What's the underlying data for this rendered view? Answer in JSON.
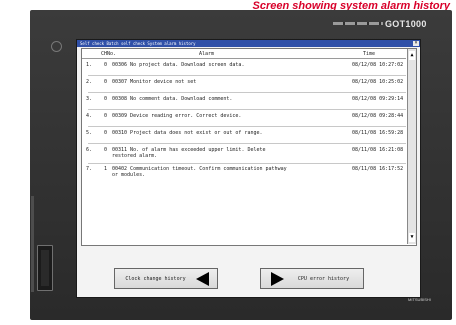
{
  "caption": "Screen showing system alarm history",
  "device": {
    "brand": "GOT1000",
    "maker": "MITSUBISHI"
  },
  "window": {
    "title": "Self check Batch self check System alarm history",
    "close_icon": "close-icon"
  },
  "table": {
    "headers": {
      "no": "CHNo.",
      "alarm": "Alarm",
      "time": "Time"
    },
    "rows": [
      {
        "idx": "1.",
        "ch": "0",
        "message": "00306 No project data. Download screen data.",
        "time": "08/12/08 10:27:02"
      },
      {
        "idx": "2.",
        "ch": "0",
        "message": "00307 Monitor device not set",
        "time": "08/12/08 10:25:02"
      },
      {
        "idx": "3.",
        "ch": "0",
        "message": "00308 No comment data. Download comment.",
        "time": "08/12/08 09:29:14"
      },
      {
        "idx": "4.",
        "ch": "0",
        "message": "00309 Device reading error. Correct device.",
        "time": "08/12/08 09:28:44"
      },
      {
        "idx": "5.",
        "ch": "0",
        "message": "00310 Project data does not exist or out of range.",
        "time": "08/11/08 16:59:28"
      },
      {
        "idx": "6.",
        "ch": "0",
        "message": "00311 No. of alarm has exceeded upper limit. Delete restored alarm.",
        "time": "08/11/08 16:21:08"
      },
      {
        "idx": "7.",
        "ch": "1",
        "message": "00402 Communication timeout. Confirm communication pathway or modules.",
        "time": "08/11/08 16:17:52"
      }
    ]
  },
  "buttons": {
    "clock_history": "Clock change history",
    "cpu_error": "CPU error history"
  },
  "scroll": {
    "up_icon": "▲",
    "down_icon": "▼"
  }
}
